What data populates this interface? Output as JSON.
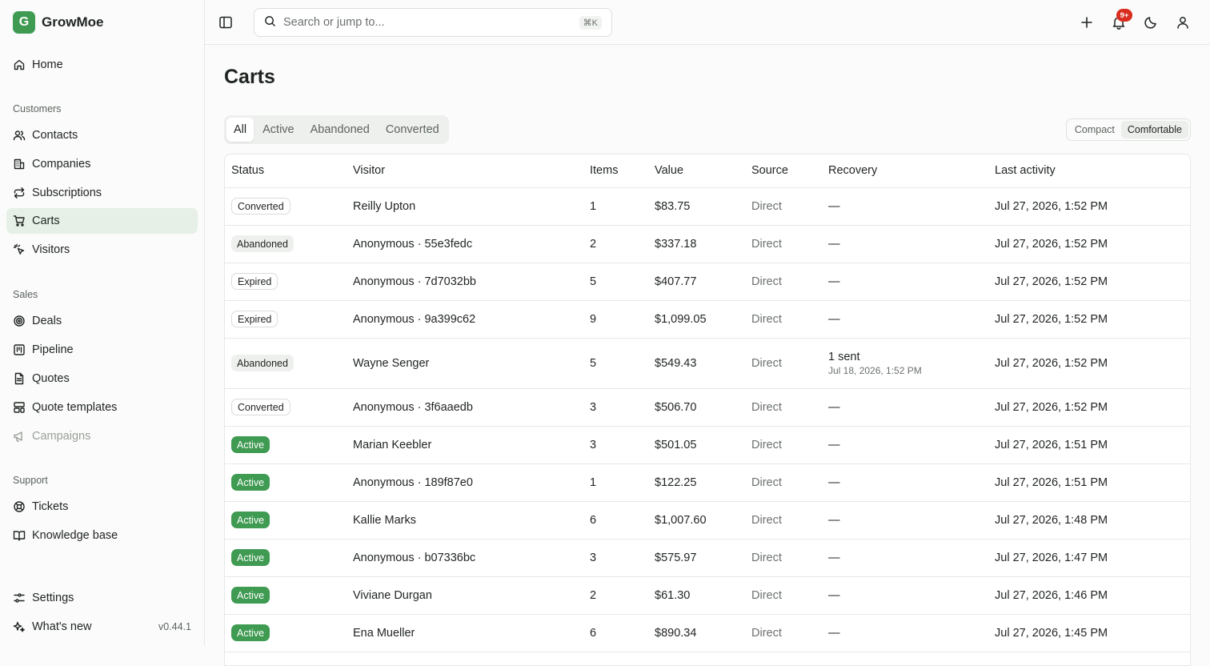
{
  "brand": {
    "letter": "G",
    "name": "GrowMoe"
  },
  "sidebar": {
    "home": "Home",
    "groups": {
      "customers": "Customers",
      "sales": "Sales",
      "support": "Support"
    },
    "items": {
      "contacts": "Contacts",
      "companies": "Companies",
      "subscriptions": "Subscriptions",
      "carts": "Carts",
      "visitors": "Visitors",
      "deals": "Deals",
      "pipeline": "Pipeline",
      "quotes": "Quotes",
      "quote_templates": "Quote templates",
      "campaigns": "Campaigns",
      "tickets": "Tickets",
      "knowledge_base": "Knowledge base",
      "settings": "Settings",
      "whats_new": "What's new"
    },
    "version": "v0.44.1"
  },
  "topbar": {
    "search_placeholder": "Search or jump to...",
    "shortcut": "⌘K",
    "notification_count": "9+"
  },
  "page": {
    "title": "Carts"
  },
  "tabs": [
    "All",
    "Active",
    "Abandoned",
    "Converted"
  ],
  "density": {
    "compact": "Compact",
    "comfortable": "Comfortable"
  },
  "table": {
    "headers": [
      "Status",
      "Visitor",
      "Items",
      "Value",
      "Source",
      "Recovery",
      "Last activity"
    ],
    "rows": [
      {
        "status": "Converted",
        "visitor": "Reilly Upton",
        "items": "1",
        "value": "$83.75",
        "source": "Direct",
        "recovery": "—",
        "recovery_sub": "",
        "last": "Jul 27, 2026, 1:52 PM"
      },
      {
        "status": "Abandoned",
        "visitor": "Anonymous · 55e3fedc",
        "items": "2",
        "value": "$337.18",
        "source": "Direct",
        "recovery": "—",
        "recovery_sub": "",
        "last": "Jul 27, 2026, 1:52 PM"
      },
      {
        "status": "Expired",
        "visitor": "Anonymous · 7d7032bb",
        "items": "5",
        "value": "$407.77",
        "source": "Direct",
        "recovery": "—",
        "recovery_sub": "",
        "last": "Jul 27, 2026, 1:52 PM"
      },
      {
        "status": "Expired",
        "visitor": "Anonymous · 9a399c62",
        "items": "9",
        "value": "$1,099.05",
        "source": "Direct",
        "recovery": "—",
        "recovery_sub": "",
        "last": "Jul 27, 2026, 1:52 PM"
      },
      {
        "status": "Abandoned",
        "visitor": "Wayne Senger",
        "items": "5",
        "value": "$549.43",
        "source": "Direct",
        "recovery": "1 sent",
        "recovery_sub": "Jul 18, 2026, 1:52 PM",
        "last": "Jul 27, 2026, 1:52 PM"
      },
      {
        "status": "Converted",
        "visitor": "Anonymous · 3f6aaedb",
        "items": "3",
        "value": "$506.70",
        "source": "Direct",
        "recovery": "—",
        "recovery_sub": "",
        "last": "Jul 27, 2026, 1:52 PM"
      },
      {
        "status": "Active",
        "visitor": "Marian Keebler",
        "items": "3",
        "value": "$501.05",
        "source": "Direct",
        "recovery": "—",
        "recovery_sub": "",
        "last": "Jul 27, 2026, 1:51 PM"
      },
      {
        "status": "Active",
        "visitor": "Anonymous · 189f87e0",
        "items": "1",
        "value": "$122.25",
        "source": "Direct",
        "recovery": "—",
        "recovery_sub": "",
        "last": "Jul 27, 2026, 1:51 PM"
      },
      {
        "status": "Active",
        "visitor": "Kallie Marks",
        "items": "6",
        "value": "$1,007.60",
        "source": "Direct",
        "recovery": "—",
        "recovery_sub": "",
        "last": "Jul 27, 2026, 1:48 PM"
      },
      {
        "status": "Active",
        "visitor": "Anonymous · b07336bc",
        "items": "3",
        "value": "$575.97",
        "source": "Direct",
        "recovery": "—",
        "recovery_sub": "",
        "last": "Jul 27, 2026, 1:47 PM"
      },
      {
        "status": "Active",
        "visitor": "Viviane Durgan",
        "items": "2",
        "value": "$61.30",
        "source": "Direct",
        "recovery": "—",
        "recovery_sub": "",
        "last": "Jul 27, 2026, 1:46 PM"
      },
      {
        "status": "Active",
        "visitor": "Ena Mueller",
        "items": "6",
        "value": "$890.34",
        "source": "Direct",
        "recovery": "—",
        "recovery_sub": "",
        "last": "Jul 27, 2026, 1:45 PM"
      }
    ]
  },
  "colors": {
    "accent": "#3f9a52",
    "active_nav": "#e6f0e6",
    "badge": "#d92d20"
  }
}
